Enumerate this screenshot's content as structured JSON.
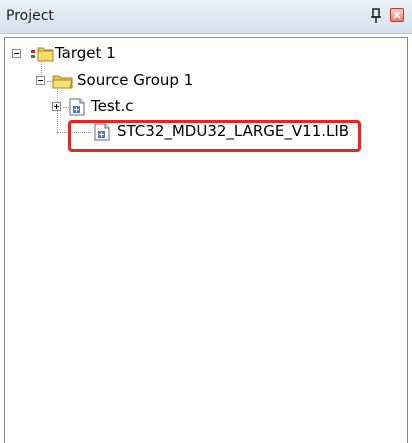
{
  "panel": {
    "title": "Project"
  },
  "tree": {
    "target": "Target 1",
    "group": "Source Group 1",
    "files": [
      "Test.c",
      "STC32_MDU32_LARGE_V11.LIB"
    ]
  },
  "icons": [
    "pin-icon",
    "close-icon",
    "target-folder-icon",
    "folder-icon",
    "c-file-icon",
    "lib-file-icon"
  ],
  "colors": {
    "highlight": "#e8251f",
    "titlebar": "#dbe4f1",
    "folder": "#f3d25a"
  }
}
